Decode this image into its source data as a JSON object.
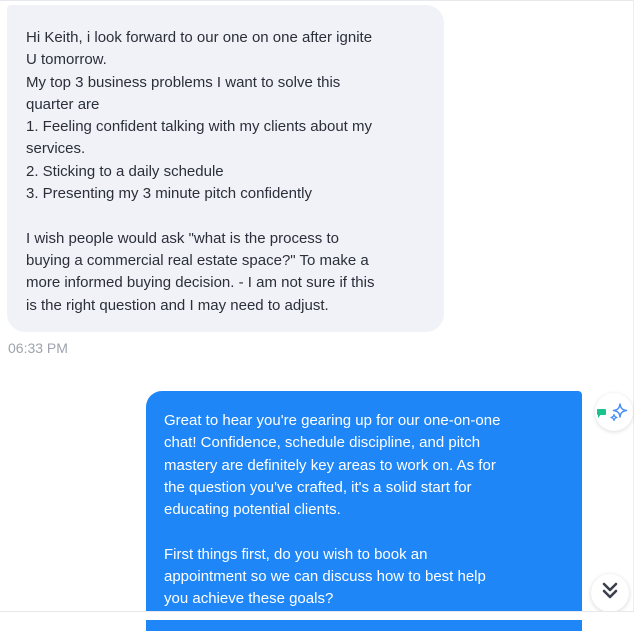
{
  "messages": [
    {
      "direction": "incoming",
      "text": "Hi Keith, i look forward to our one on one after ignite\nU tomorrow.\nMy top 3 business problems I want to solve this\nquarter are\n1. Feeling confident talking with my clients about my\nservices.\n2. Sticking to a daily schedule\n3. Presenting my 3 minute pitch confidently\n\nI wish people would ask \"what is the process to\nbuying a commercial real estate space?\" To make a\nmore informed buying decision. - I am not sure if this\nis the right question and I may need to adjust.",
      "timestamp": "06:33 PM"
    },
    {
      "direction": "outgoing",
      "text": "Great to hear you're gearing up for our one-on-one\nchat! Confidence, schedule discipline, and pitch\nmastery are definitely key areas to work on. As for\nthe question you've crafted, it's a solid start for\neducating potential clients.\n\nFirst things first, do you wish to book an\nappointment so we can discuss how to best help\nyou achieve these goals?"
    }
  ],
  "icons": {
    "ai_badge": "ai-sparkle-icon",
    "flag": "flag-icon",
    "scroll_down": "double-chevron-down-icon"
  },
  "colors": {
    "incoming_bubble": "#f0f2f7",
    "outgoing_bubble": "#1e86f7",
    "flag": "#1cc28c",
    "sparkle": "#4a8ef5",
    "timestamp": "#9ea3ad"
  }
}
